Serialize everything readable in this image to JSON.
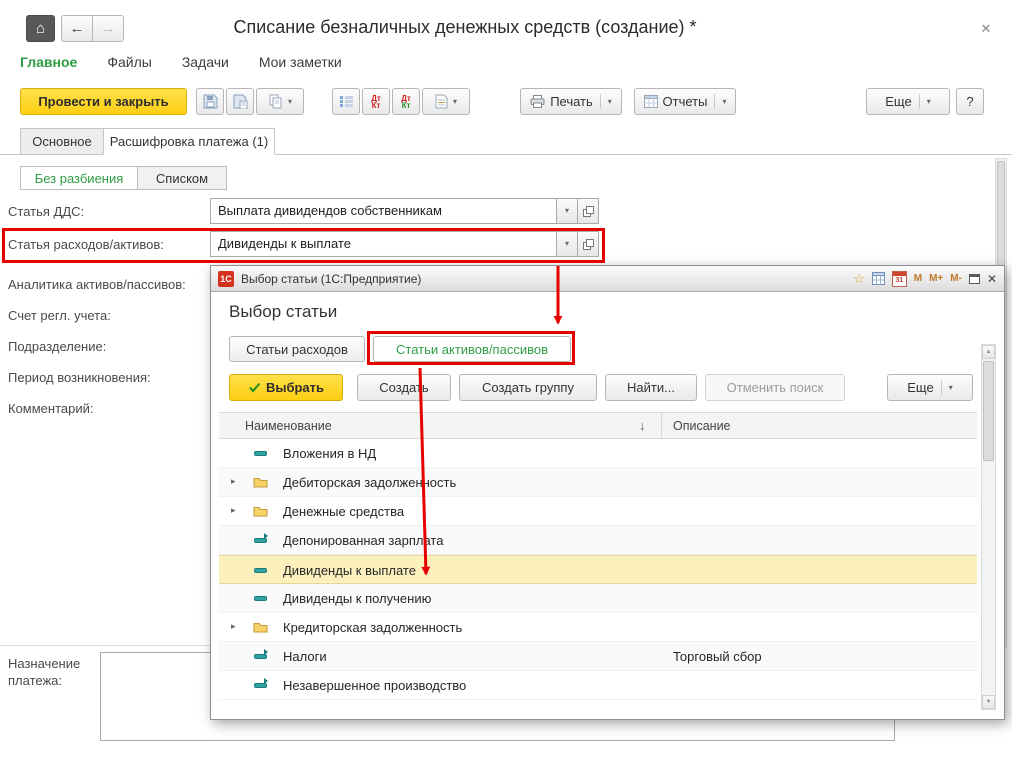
{
  "colors": {
    "accent_green": "#2e9e43",
    "button_yellow": "#fecf13",
    "annotation_red": "#e60000",
    "selection_yellow": "#fcf1bd"
  },
  "window": {
    "title": "Списание безналичных денежных средств (создание) *"
  },
  "nav": {
    "items": [
      {
        "label": "Главное",
        "active": true
      },
      {
        "label": "Файлы",
        "active": false
      },
      {
        "label": "Задачи",
        "active": false
      },
      {
        "label": "Мои заметки",
        "active": false
      }
    ]
  },
  "toolbar": {
    "post_and_close": "Провести и закрыть",
    "print": "Печать",
    "reports": "Отчеты",
    "more": "Еще",
    "help": "?"
  },
  "tabs": [
    {
      "label": "Основное",
      "active": false
    },
    {
      "label": "Расшифровка платежа (1)",
      "active": true
    }
  ],
  "view_switch": [
    {
      "label": "Без разбиения",
      "active": true
    },
    {
      "label": "Списком",
      "active": false
    }
  ],
  "form": {
    "fields": [
      {
        "label": "Статья ДДС:",
        "value": "Выплата дивидендов собственникам"
      },
      {
        "label": "Статья расходов/активов:",
        "value": "Дивиденды к выплате"
      },
      {
        "label": "Аналитика активов/пассивов:",
        "value": ""
      },
      {
        "label": "Счет регл. учета:",
        "value": ""
      },
      {
        "label": "Подразделение:",
        "value": ""
      },
      {
        "label": "Период возникновения:",
        "value": ""
      },
      {
        "label": "Комментарий:",
        "value": ""
      }
    ],
    "payment_purpose_label": "Назначение платежа:"
  },
  "dialog": {
    "titlebar": {
      "app_badge": "1С",
      "title": "Выбор статьи (1С:Предприятие)",
      "memory_buttons": [
        "М",
        "М+",
        "М-"
      ],
      "calendar_day": "31"
    },
    "heading": "Выбор статьи",
    "tabs": [
      {
        "label": "Статьи расходов",
        "active": false
      },
      {
        "label": "Статьи активов/пассивов",
        "active": true
      }
    ],
    "buttons": {
      "select": "Выбрать",
      "create": "Создать",
      "create_group": "Создать группу",
      "find": "Найти...",
      "cancel_search": "Отменить поиск",
      "more": "Еще"
    },
    "table": {
      "columns": [
        {
          "label": "Наименование"
        },
        {
          "label": "Описание"
        }
      ],
      "sort_glyph": "↓",
      "rows": [
        {
          "name": "Вложения в НД",
          "description": "",
          "type": "item",
          "selected": false
        },
        {
          "name": "Дебиторская задолженность",
          "description": "",
          "type": "group",
          "selected": false
        },
        {
          "name": "Денежные средства",
          "description": "",
          "type": "group",
          "selected": false
        },
        {
          "name": "Депонированная зарплата",
          "description": "",
          "type": "item-alt",
          "selected": false
        },
        {
          "name": "Дивиденды к выплате",
          "description": "",
          "type": "item",
          "selected": true
        },
        {
          "name": "Дивиденды к получению",
          "description": "",
          "type": "item",
          "selected": false
        },
        {
          "name": "Кредиторская задолженность",
          "description": "",
          "type": "group",
          "selected": false
        },
        {
          "name": "Налоги",
          "description": "Торговый сбор",
          "type": "item-alt",
          "selected": false
        },
        {
          "name": "Незавершенное производство",
          "description": "",
          "type": "item-alt",
          "selected": false
        }
      ]
    }
  },
  "glyphs": {
    "home": "⌂",
    "back": "←",
    "forward": "→",
    "dropdown": "▾",
    "expander": "▸",
    "star": "☆",
    "close": "✕",
    "scroll_up": "▲",
    "scroll_down": "▼",
    "dt": "Дт",
    "kt": "Кт"
  }
}
